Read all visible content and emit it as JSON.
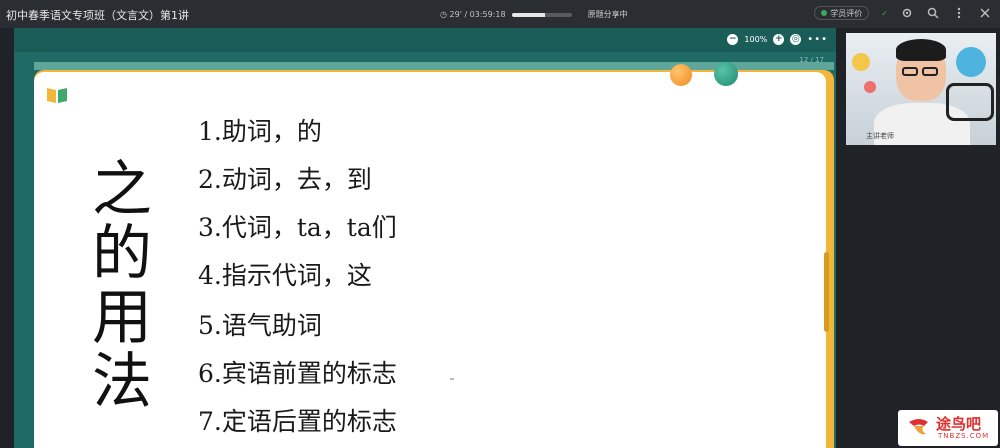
{
  "window": {
    "course_title": "初中春季语文专项班（文言文）第1讲",
    "time_text": "◷ 29' / 03:59:18",
    "playback_progress": 0.55,
    "status_label": "原题分享中",
    "record_label": "学员评价",
    "signal_label": "✓"
  },
  "toolbar": {
    "zoom_minus": "−",
    "zoom_level": "100%",
    "zoom_plus": "+",
    "more": "•••",
    "page_tag": "12 / 17"
  },
  "slide": {
    "title_chars": [
      "之",
      "的",
      "用",
      "法"
    ],
    "items": [
      "1.助词，的",
      "2.动词，去，到",
      "3.代词，ta，ta们",
      "4.指示代词，这",
      "5.语气助词",
      "6.宾语前置的标志",
      "7.定语后置的标志"
    ],
    "colors": {
      "frame": "#1f6a65",
      "border": "#f2b73a",
      "accent_orange": "#f08a1c",
      "accent_teal": "#1e8a6c"
    }
  },
  "webcam": {
    "label": "主讲老师"
  },
  "watermark": {
    "text": "途鸟吧",
    "sub": "TNBZS.COM"
  },
  "icons": {
    "book": "book-icon",
    "search": "search-icon",
    "settings": "gear-icon",
    "menu": "vertical-dots-icon",
    "close": "close-icon"
  }
}
